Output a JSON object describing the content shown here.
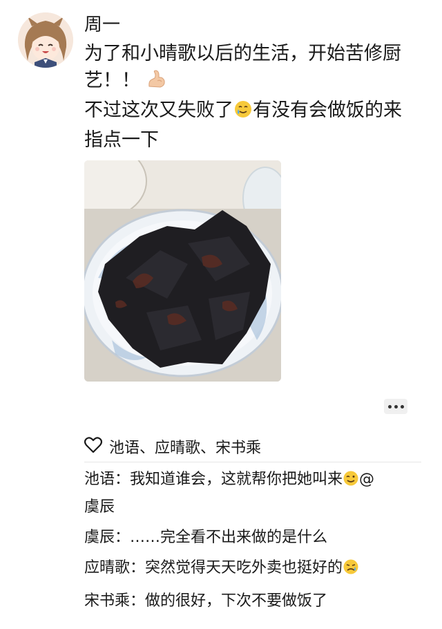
{
  "post": {
    "author": "周一",
    "lines": [
      "为了和小晴歌以后的生活，开始苦修厨",
      "艺！！",
      "不过这次又失败了",
      "有没有会做饭的来",
      "指点一下"
    ]
  },
  "icons": {
    "avatar": "anime-girl-avatar",
    "arm_emoji": "flexed-biceps-emoji",
    "tear_emoji": "smiling-face-with-tear-emoji",
    "more": "more-dots-icon",
    "like": "heart-outline-icon",
    "wink_emoji": "winking-face-emoji",
    "sad_emoji": "sad-but-relieved-face-emoji"
  },
  "likes": {
    "names": "池语、应晴歌、宋书乘"
  },
  "comments": [
    {
      "author": "池语",
      "separator": "：",
      "text": "我知道谁会，这就帮你把她叫来",
      "mention_at": "@",
      "mention_rest": "虞辰"
    },
    {
      "author": "虞辰",
      "separator": "：",
      "text": "……完全看不出来做的是什么"
    },
    {
      "author": "应晴歌",
      "separator": "：",
      "text": "突然觉得天天吃外卖也挺好的"
    },
    {
      "author": "宋书乘",
      "separator": "：",
      "text": "做的很好，下次不要做饭了"
    }
  ]
}
